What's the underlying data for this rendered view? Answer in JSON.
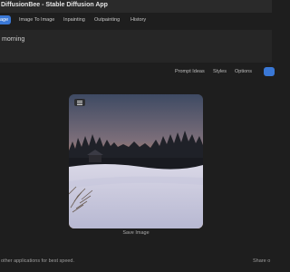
{
  "app": {
    "title": "DiffusionBee - Stable Diffusion App"
  },
  "tabs": [
    {
      "label": "Text To Image",
      "visible_label": "age",
      "active": true
    },
    {
      "label": "Image To Image"
    },
    {
      "label": "Inpainting"
    },
    {
      "label": "Outpainting"
    },
    {
      "label": "History"
    }
  ],
  "prompt": {
    "value": "morning"
  },
  "toolbar": {
    "prompt_ideas": "Prompt Ideas",
    "styles": "Styles",
    "options": "Options"
  },
  "image": {
    "save_label": "Save Image"
  },
  "footer": {
    "left_text": "other applications for best speed.",
    "right_text": "Share o"
  },
  "colors": {
    "accent": "#3a78d6",
    "background": "#1e1e1e"
  }
}
